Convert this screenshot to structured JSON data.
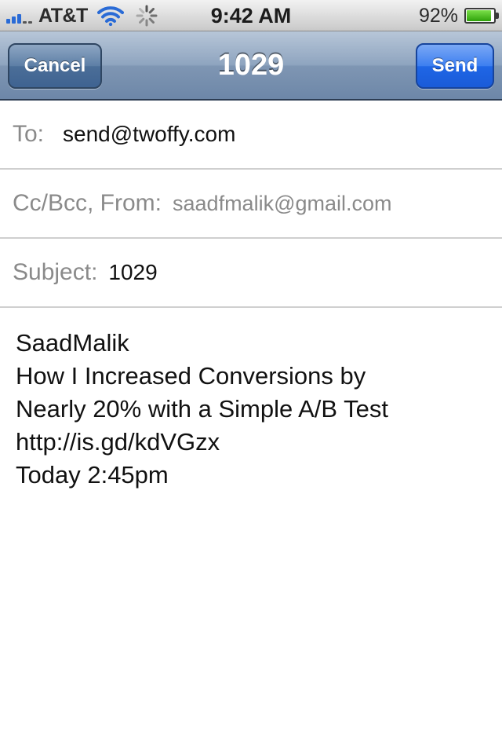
{
  "status_bar": {
    "carrier": "AT&T",
    "time": "9:42 AM",
    "battery_percent": "92",
    "battery_percent_suffix": "%",
    "battery_level": 0.92
  },
  "nav": {
    "cancel_label": "Cancel",
    "title": "1029",
    "send_label": "Send"
  },
  "fields": {
    "to_label": "To:",
    "to_value": "send@twoffy.com",
    "ccbcc_label": "Cc/Bcc, From:",
    "from_value": "saadfmalik@gmail.com",
    "subject_label": "Subject:",
    "subject_value": "1029"
  },
  "body": {
    "lines": [
      "SaadMalik",
      "How I Increased Conversions by",
      "Nearly 20% with a Simple A/B Test",
      "http://is.gd/kdVGzx",
      "Today 2:45pm"
    ]
  },
  "colors": {
    "send_button": "#1f66e6",
    "navbar": "#8ea4bf",
    "label_gray": "#8a8a8a"
  },
  "icons": [
    "signal-icon",
    "wifi-icon",
    "activity-spinner-icon",
    "battery-icon"
  ]
}
